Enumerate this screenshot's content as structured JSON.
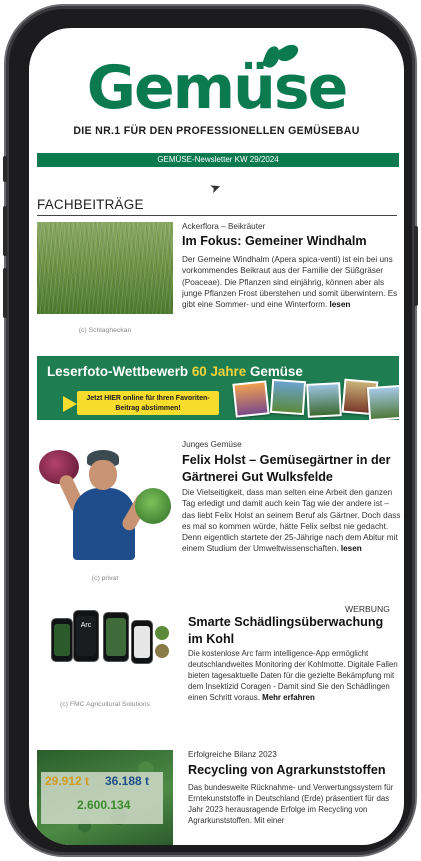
{
  "brand": {
    "logo": "Gemüse",
    "tagline": "DIE NR.1 FÜR DEN PROFESSIONELLEN GEMÜSEBAU"
  },
  "newsletter_bar": "GEMÜSE-Newsletter KW 29/2024",
  "section_title": "FACHBEITRÄGE",
  "colors": {
    "brand_green": "#0b7a4f",
    "cta_yellow": "#f6dc2c",
    "banner_green": "#1f7d52"
  },
  "articles": [
    {
      "kicker": "Ackerflora – Beikräuter",
      "headline": "Im Fokus: Gemeiner Windhalm",
      "body": "Der Gemeine Windhalm (Apera spica-venti) ist ein bei uns vorkommendes Beikraut aus der Familie der Süßgräser (Poaceae). Die Pflanzen sind einjährig, können aber als junge Pflanzen Frost überstehen und somit überwintern. Es gibt eine Sommer- und eine Winterform.",
      "more": "lesen",
      "caption": "(c) Schlagheckan"
    },
    {
      "kicker": "Junges Gemüse",
      "headline": "Felix Holst – Gemüsegärtner in der Gärtnerei Gut Wulksfelde",
      "body": "Die Vielseitigkeit, dass man selten eine Arbeit den ganzen Tag erledigt und damit auch kein Tag wie der andere ist – das liebt Felix Holst an seinem Beruf als Gärtner. Doch dass es mal so kommen würde, hätte Felix selbst nie gedacht. Denn eigentlich startete der 25-Jährige nach dem Abitur mit einem Studium der Umweltwissenschaften.",
      "more": "lesen",
      "caption": "(c) privat"
    },
    {
      "label": "WERBUNG",
      "headline": "Smarte Schädlingsüberwachung im Kohl",
      "body": "Die kostenlose Arc farm intelligence-App ermöglicht deutschlandweites Monitoring der Kohlmotte. Digitale Fallen bieten tagesaktuelle Daten für die gezielte Bekämpfung mit dem Insektizid Coragen - Damit sind Sie den Schädlingen einen Schritt voraus.",
      "more": "Mehr erfahren",
      "caption": "(c) FMC Agricultural Solutions",
      "app_name": "Arc"
    },
    {
      "kicker": "Erfolgreiche Bilanz 2023",
      "headline": "Recycling von Agrarkunststoffen",
      "body": "Das bundesweite Rücknahme- und Verwertungssystem für Erntekunststoffe in Deutschland (Erde) präsentiert für das Jahr 2023 herausragende Erfolge im Recycling von Agrarkunststoffen. Mit einer",
      "stats": [
        "29.912 t",
        "36.188 t",
        "2.600.134"
      ]
    }
  ],
  "banner": {
    "title_prefix": "Leserfoto-Wettbewerb",
    "title_year": "60 Jahre",
    "title_logo": "Gemüse",
    "cta": "Jetzt HIER online für Ihren Favoriten-Beitrag abstimmen!"
  }
}
